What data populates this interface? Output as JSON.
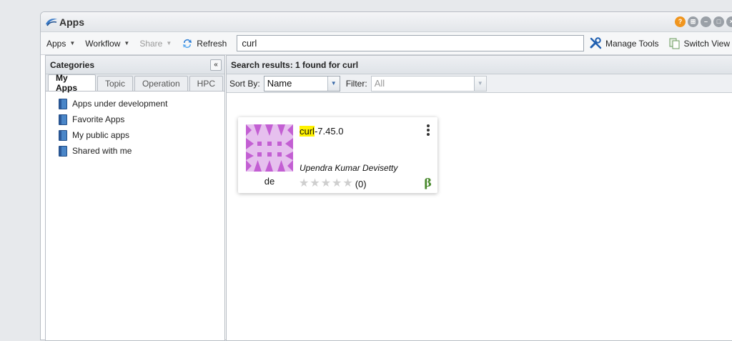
{
  "window": {
    "title": "Apps",
    "controls": {
      "help": "?",
      "grid": "⊞",
      "minimize": "–",
      "restore": "□",
      "close": "×"
    }
  },
  "toolbar": {
    "apps_label": "Apps",
    "workflow_label": "Workflow",
    "share_label": "Share",
    "refresh_label": "Refresh",
    "search_value": "curl",
    "manage_tools_label": "Manage Tools",
    "switch_view_label": "Switch View"
  },
  "categories": {
    "title": "Categories",
    "collapse_glyph": "«",
    "tabs": [
      {
        "label": "My Apps",
        "active": true
      },
      {
        "label": "Topic"
      },
      {
        "label": "Operation"
      },
      {
        "label": "HPC"
      }
    ],
    "items": [
      {
        "label": "Apps under development"
      },
      {
        "label": "Favorite Apps"
      },
      {
        "label": "My public apps"
      },
      {
        "label": "Shared with me"
      }
    ]
  },
  "results": {
    "header": "Search results: 1 found for curl",
    "sort_label": "Sort By:",
    "sort_value": "Name",
    "filter_label": "Filter:",
    "filter_value": "All",
    "apps": [
      {
        "name_highlight": "curl",
        "name_rest": "-7.45.0",
        "integrator": "Upendra Kumar Devisetty",
        "integrator_short": "de",
        "rating_count": "(0)",
        "rating_stars": 0,
        "beta_badge": "β"
      }
    ]
  },
  "colors": {
    "thumbnail_purple": "#c35fd3",
    "highlight_yellow": "#fff200",
    "beta_green": "#4a8a2e",
    "help_orange": "#f0951e"
  }
}
